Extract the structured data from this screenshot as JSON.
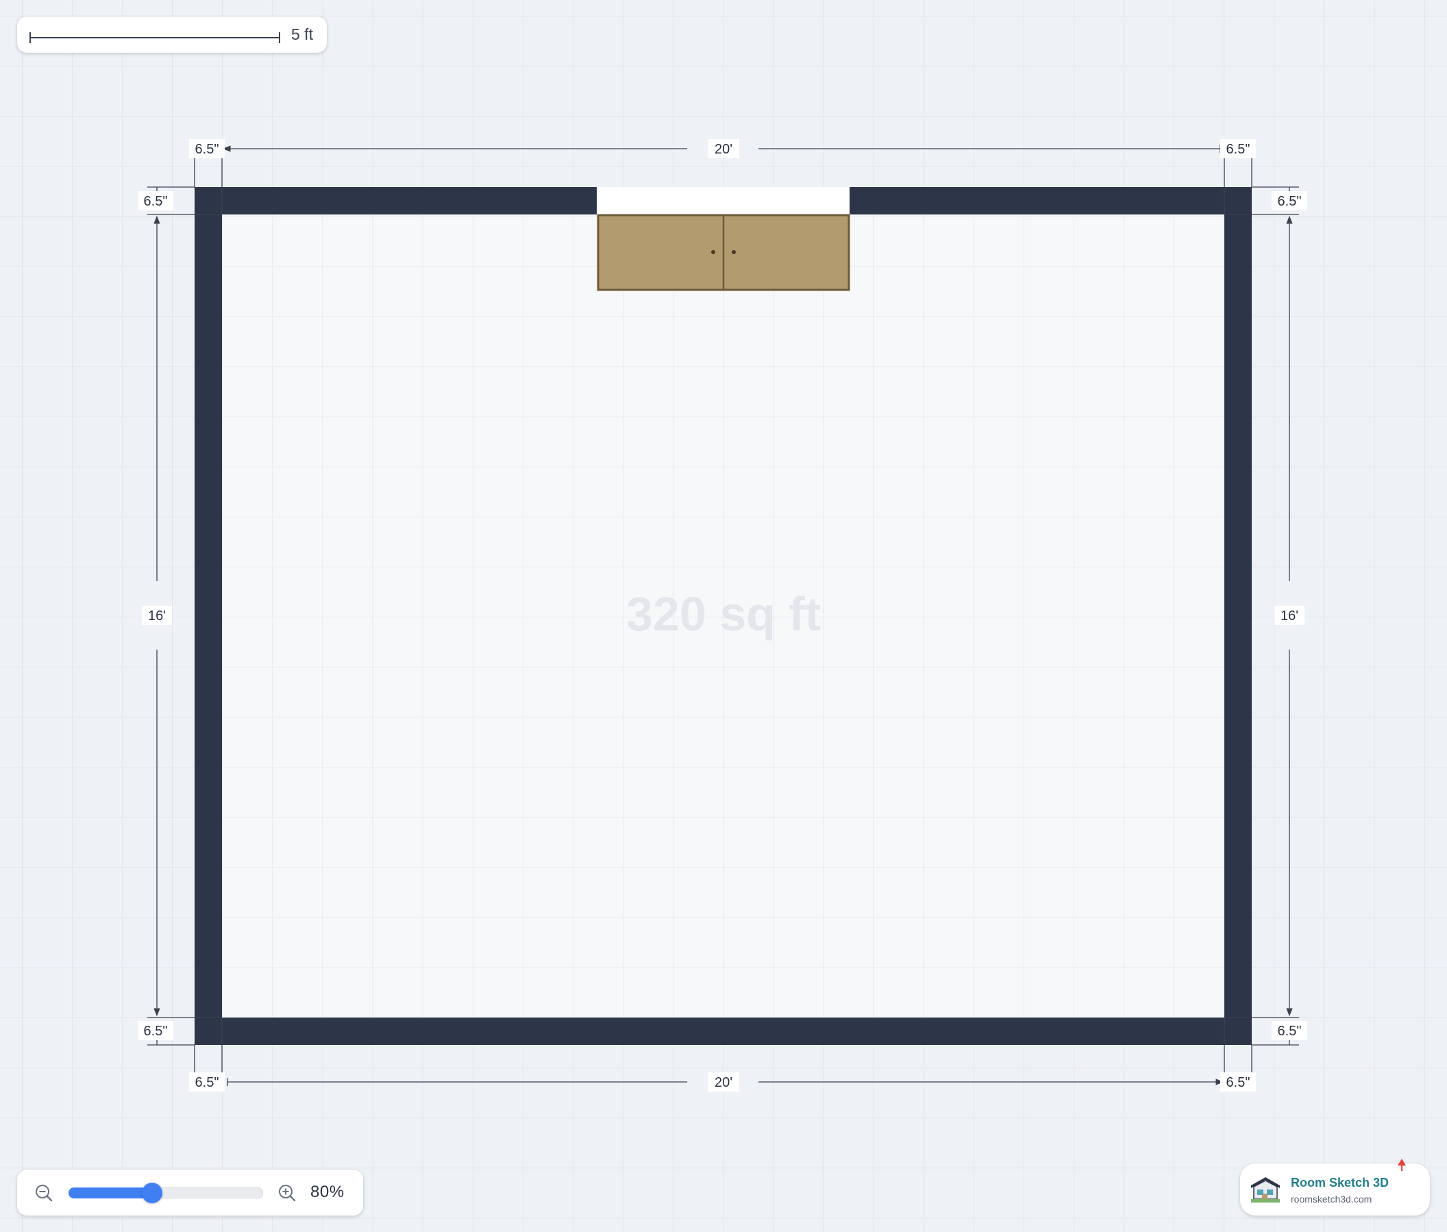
{
  "colors": {
    "canvas_background": "#eef1f5",
    "grid_line": "#d9dde4",
    "floor": "#f7f8fa",
    "wall": "#2d3648",
    "cabinet_fill": "#b39b70",
    "cabinet_border": "#6b5a36",
    "accent": "#3f7ff0",
    "brand": "#1f7f8f"
  },
  "scale_bar": {
    "label": "5 ft"
  },
  "room": {
    "area_label": "320 sq ft",
    "width_label": "20'",
    "depth_label": "16'",
    "wall_thickness_label": "6.5\"",
    "furniture": [
      {
        "type": "two-door cabinet",
        "icon": "cabinet-icon"
      }
    ]
  },
  "dimensions": {
    "top": {
      "left": "6.5\"",
      "middle": "20'",
      "right": "6.5\""
    },
    "bottom": {
      "left": "6.5\"",
      "middle": "20'",
      "right": "6.5\""
    },
    "left": {
      "top": "6.5\"",
      "middle": "16'",
      "bottom": "6.5\""
    },
    "right": {
      "top": "6.5\"",
      "middle": "16'",
      "bottom": "6.5\""
    }
  },
  "zoom": {
    "level_label": "80%",
    "level": 0.43,
    "out_icon": "zoom-out-icon",
    "in_icon": "zoom-in-icon"
  },
  "brand": {
    "name": "Room Sketch 3D",
    "url": "roomsketch3d.com",
    "logo_icon": "house-logo-icon"
  }
}
